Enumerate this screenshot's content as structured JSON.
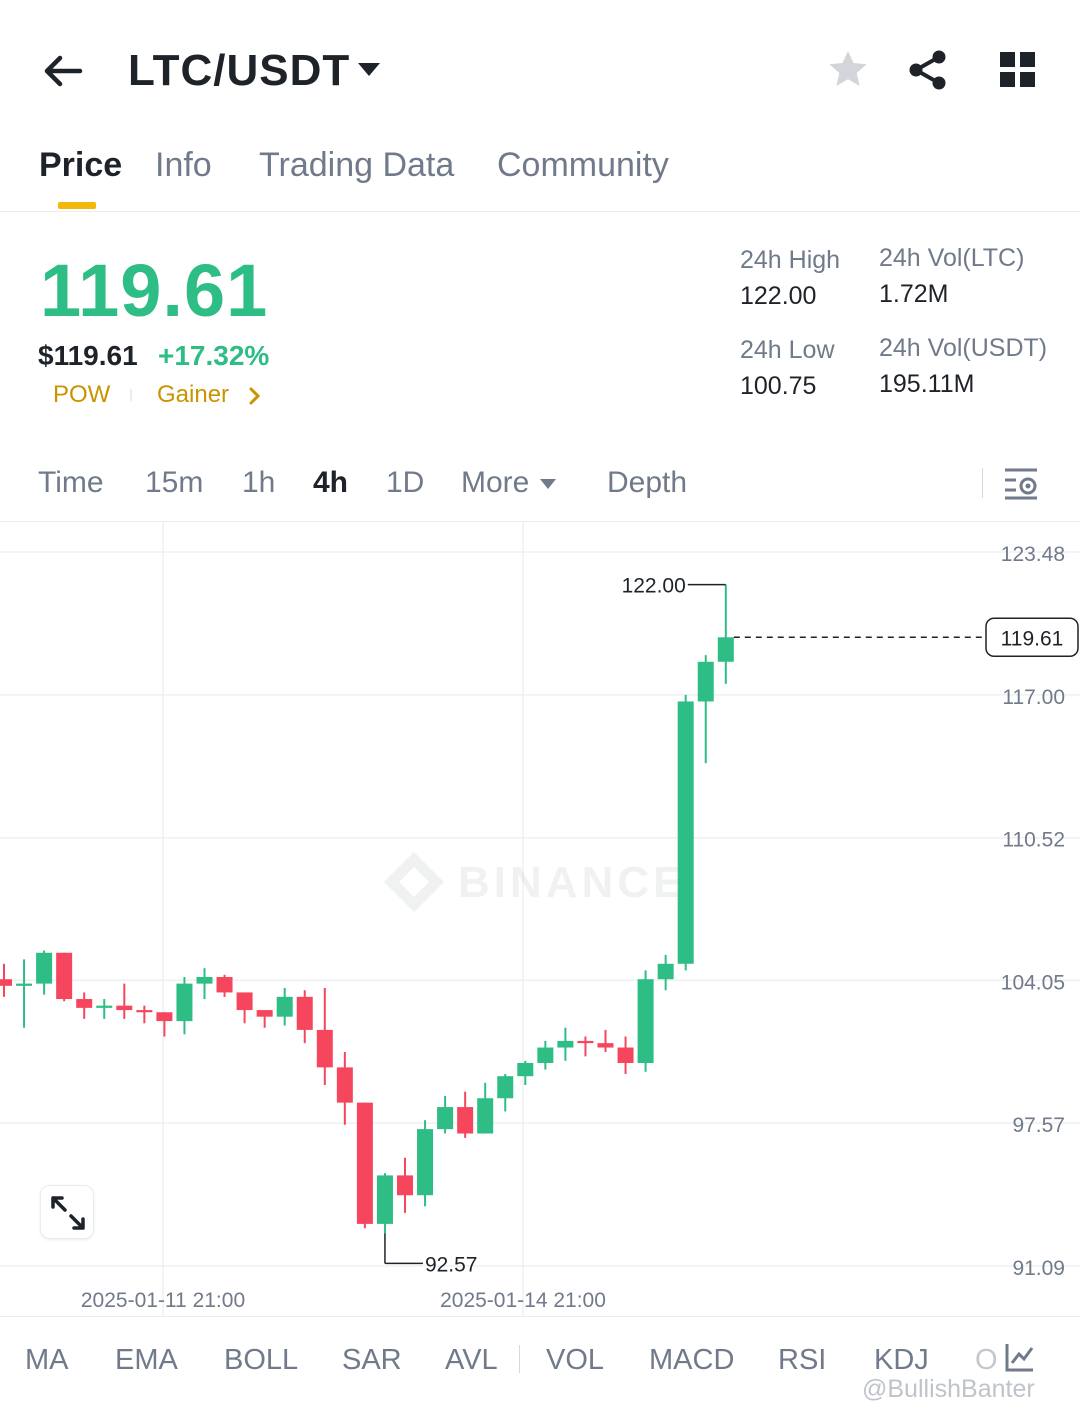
{
  "header": {
    "pair": "LTC/USDT",
    "icons": [
      "back-arrow-icon",
      "caret-down-icon",
      "star-icon",
      "share-icon",
      "grid-icon"
    ]
  },
  "tabs": [
    {
      "label": "Price",
      "active": true
    },
    {
      "label": "Info",
      "active": false
    },
    {
      "label": "Trading Data",
      "active": false
    },
    {
      "label": "Community",
      "active": false
    }
  ],
  "ticker": {
    "last_price": "119.61",
    "usd_price": "$119.61",
    "change": "+17.32%",
    "tag_1": "POW",
    "tag_2": "Gainer",
    "high_label": "24h High",
    "high_value": "122.00",
    "low_label": "24h Low",
    "low_value": "100.75",
    "vol_ltc_label": "24h Vol(LTC)",
    "vol_ltc_value": "1.72M",
    "vol_usdt_label": "24h Vol(USDT)",
    "vol_usdt_value": "195.11M",
    "up_color": "#2ebd85",
    "down_color": "#f6465d",
    "tag_color": "#c99400"
  },
  "timeframes": [
    {
      "label": "Time",
      "active": false
    },
    {
      "label": "15m",
      "active": false
    },
    {
      "label": "1h",
      "active": false
    },
    {
      "label": "4h",
      "active": true
    },
    {
      "label": "1D",
      "active": false
    },
    {
      "label": "More",
      "active": false
    },
    {
      "label": "Depth",
      "active": false
    }
  ],
  "chart_data": {
    "type": "candlestick",
    "interval": "4h",
    "watermark": "BINANCE",
    "y_ticks": [
      "123.48",
      "117.00",
      "110.52",
      "104.05",
      "97.57",
      "91.09"
    ],
    "ylim": [
      91.09,
      123.48
    ],
    "x_ticks": [
      "2025-01-11 21:00",
      "2025-01-14 21:00"
    ],
    "high_marker": "122.00",
    "low_marker": "92.57",
    "last_price_marker": "119.61",
    "grid": true,
    "candles": [
      {
        "o": 104.1,
        "h": 104.8,
        "l": 103.3,
        "c": 103.8
      },
      {
        "o": 103.8,
        "h": 105.0,
        "l": 101.9,
        "c": 103.9
      },
      {
        "o": 103.9,
        "h": 105.4,
        "l": 103.4,
        "c": 105.3
      },
      {
        "o": 105.3,
        "h": 105.3,
        "l": 103.1,
        "c": 103.2
      },
      {
        "o": 103.2,
        "h": 103.5,
        "l": 102.3,
        "c": 102.8
      },
      {
        "o": 102.8,
        "h": 103.2,
        "l": 102.3,
        "c": 102.9
      },
      {
        "o": 102.9,
        "h": 103.9,
        "l": 102.3,
        "c": 102.7
      },
      {
        "o": 102.7,
        "h": 102.9,
        "l": 102.1,
        "c": 102.6
      },
      {
        "o": 102.6,
        "h": 102.6,
        "l": 101.5,
        "c": 102.2
      },
      {
        "o": 102.2,
        "h": 104.2,
        "l": 101.6,
        "c": 103.9
      },
      {
        "o": 103.9,
        "h": 104.6,
        "l": 103.2,
        "c": 104.2
      },
      {
        "o": 104.2,
        "h": 104.3,
        "l": 103.3,
        "c": 103.5
      },
      {
        "o": 103.5,
        "h": 103.5,
        "l": 102.1,
        "c": 102.7
      },
      {
        "o": 102.7,
        "h": 102.7,
        "l": 101.9,
        "c": 102.4
      },
      {
        "o": 102.4,
        "h": 103.7,
        "l": 102.0,
        "c": 103.3
      },
      {
        "o": 103.3,
        "h": 103.6,
        "l": 101.2,
        "c": 101.8
      },
      {
        "o": 101.8,
        "h": 103.7,
        "l": 99.3,
        "c": 100.1
      },
      {
        "o": 100.1,
        "h": 100.8,
        "l": 97.5,
        "c": 98.5
      },
      {
        "o": 98.5,
        "h": 98.5,
        "l": 92.8,
        "c": 93.0
      },
      {
        "o": 93.0,
        "h": 95.3,
        "l": 92.57,
        "c": 95.2
      },
      {
        "o": 95.2,
        "h": 96.0,
        "l": 93.5,
        "c": 94.3
      },
      {
        "o": 94.3,
        "h": 97.7,
        "l": 93.8,
        "c": 97.3
      },
      {
        "o": 97.3,
        "h": 98.8,
        "l": 97.1,
        "c": 98.3
      },
      {
        "o": 98.3,
        "h": 99.0,
        "l": 96.9,
        "c": 97.1
      },
      {
        "o": 97.1,
        "h": 99.4,
        "l": 97.1,
        "c": 98.7
      },
      {
        "o": 98.7,
        "h": 99.8,
        "l": 98.1,
        "c": 99.7
      },
      {
        "o": 99.7,
        "h": 100.4,
        "l": 99.3,
        "c": 100.3
      },
      {
        "o": 100.3,
        "h": 101.3,
        "l": 100.0,
        "c": 101.0
      },
      {
        "o": 101.0,
        "h": 101.9,
        "l": 100.4,
        "c": 101.3
      },
      {
        "o": 101.3,
        "h": 101.5,
        "l": 100.6,
        "c": 101.2
      },
      {
        "o": 101.2,
        "h": 101.8,
        "l": 100.8,
        "c": 101.0
      },
      {
        "o": 101.0,
        "h": 101.5,
        "l": 99.8,
        "c": 100.3
      },
      {
        "o": 100.3,
        "h": 104.5,
        "l": 99.9,
        "c": 104.1
      },
      {
        "o": 104.1,
        "h": 105.2,
        "l": 103.6,
        "c": 104.8
      },
      {
        "o": 104.8,
        "h": 117.0,
        "l": 104.5,
        "c": 116.7
      },
      {
        "o": 116.7,
        "h": 118.8,
        "l": 113.9,
        "c": 118.5
      },
      {
        "o": 118.5,
        "h": 122.0,
        "l": 117.5,
        "c": 119.61
      }
    ]
  },
  "indicators": [
    "MA",
    "EMA",
    "BOLL",
    "SAR",
    "AVL",
    "VOL",
    "MACD",
    "RSI",
    "KDJ",
    "O"
  ],
  "footer": {
    "watermark": "@BullishBanter"
  }
}
